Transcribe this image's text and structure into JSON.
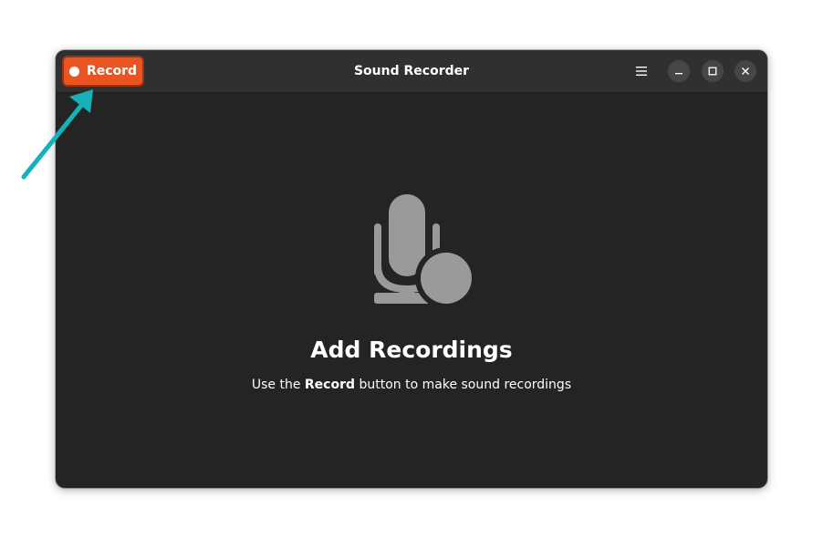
{
  "window": {
    "title": "Sound Recorder"
  },
  "headerbar": {
    "record_label": "Record",
    "menu_icon": "hamburger-menu-icon",
    "minimize_icon": "minimize-icon",
    "maximize_icon": "maximize-icon",
    "close_icon": "close-icon"
  },
  "empty_state": {
    "icon": "microphone-record-icon",
    "title": "Add Recordings",
    "description_prefix": "Use the ",
    "description_bold": "Record",
    "description_suffix": " button to make sound recordings"
  },
  "colors": {
    "accent": "#e95420",
    "arrow": "#17b1b9",
    "window_bg": "#242424",
    "headerbar_bg": "#303030"
  }
}
